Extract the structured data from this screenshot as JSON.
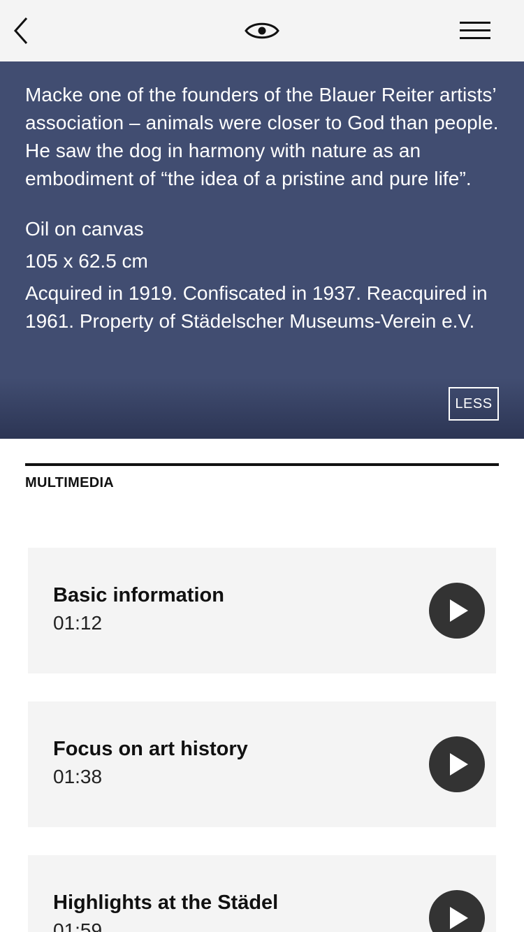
{
  "nav": {
    "back_icon": "chevron-left-icon",
    "view_icon": "eye-icon",
    "menu_icon": "hamburger-icon"
  },
  "description": {
    "lines": [
      "Macke one of the founders of the Blauer Reiter artists’",
      "association – animals were closer to God than people.",
      "He saw the dog in harmony with nature as an",
      "embodiment of “the idea of a pristine and pure life”."
    ],
    "medium": "Oil on canvas",
    "dimensions": "105 x 62.5 cm",
    "provenance_line1": "Acquired in 1919. Confiscated in 1937. Reacquired in",
    "provenance_line2": "1961. Property of Städelscher Museums-Verein e.V.",
    "less_label": "LESS"
  },
  "multimedia": {
    "title": "MULTIMEDIA",
    "items": [
      {
        "title": "Basic information",
        "duration": "01:12"
      },
      {
        "title": "Focus on art history",
        "duration": "01:38"
      },
      {
        "title": "Highlights at the Städel",
        "duration": "01:59"
      }
    ]
  },
  "colors": {
    "panel": "#414d71",
    "topbar": "#f4f4f4",
    "card": "#f4f4f4",
    "play": "#333333"
  }
}
